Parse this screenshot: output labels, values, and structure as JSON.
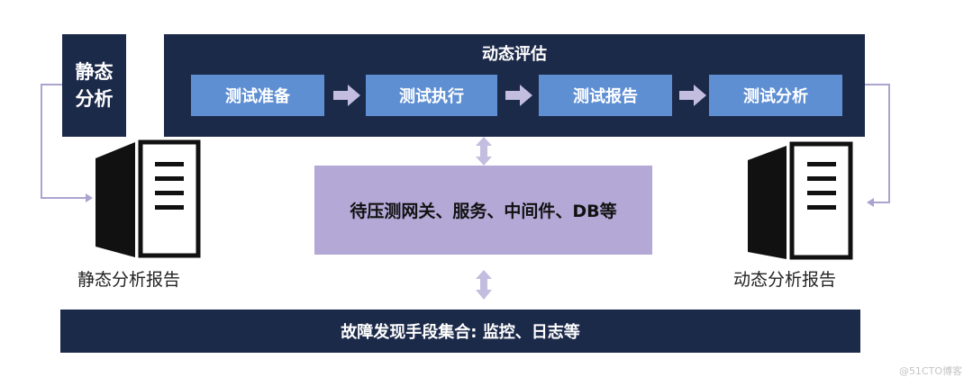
{
  "static_analysis": {
    "label": "静态分析"
  },
  "dynamic_eval": {
    "title": "动态评估",
    "steps": [
      {
        "label": "测试准备"
      },
      {
        "label": "测试执行"
      },
      {
        "label": "测试报告"
      },
      {
        "label": "测试分析"
      }
    ]
  },
  "target": {
    "label": "待压测网关、服务、中间件、DB等"
  },
  "fault_tools": {
    "label": "故障发现手段集合: 监控、日志等"
  },
  "reports": {
    "static": "静态分析报告",
    "dynamic": "动态分析报告"
  },
  "watermark": {
    "text": "@51CTO博客"
  },
  "colors": {
    "navy": "#1c2a4a",
    "step_blue": "#5f8fd3",
    "lavender": "#b3a8d6",
    "arrow": "#c3bde0",
    "connector": "#a9a4d0"
  }
}
